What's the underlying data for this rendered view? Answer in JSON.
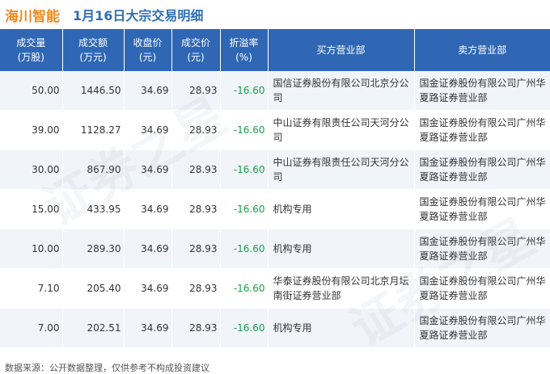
{
  "header": {
    "company": "海川智能",
    "subtitle": "1月16日大宗交易明细"
  },
  "table": {
    "columns": [
      [
        "成交量",
        "(万股)"
      ],
      [
        "成交额",
        "(万元)"
      ],
      [
        "收盘价",
        "(元)"
      ],
      [
        "成交价",
        "(元)"
      ],
      [
        "折溢率",
        "(%)"
      ],
      [
        "买方营业部"
      ],
      [
        "卖方营业部"
      ]
    ],
    "rows": [
      {
        "volume": "50.00",
        "amount": "1446.50",
        "close": "34.69",
        "price": "28.93",
        "premium": "-16.60",
        "buyer": "国信证券股份有限公司北京分公司",
        "seller": "国金证券股份有限公司广州华夏路证券营业部"
      },
      {
        "volume": "39.00",
        "amount": "1128.27",
        "close": "34.69",
        "price": "28.93",
        "premium": "-16.60",
        "buyer": "中山证券有限责任公司天河分公司",
        "seller": "国金证券股份有限公司广州华夏路证券营业部"
      },
      {
        "volume": "30.00",
        "amount": "867.90",
        "close": "34.69",
        "price": "28.93",
        "premium": "-16.60",
        "buyer": "中山证券有限责任公司天河分公司",
        "seller": "国金证券股份有限公司广州华夏路证券营业部"
      },
      {
        "volume": "15.00",
        "amount": "433.95",
        "close": "34.69",
        "price": "28.93",
        "premium": "-16.60",
        "buyer": "机构专用",
        "seller": "国金证券股份有限公司广州华夏路证券营业部"
      },
      {
        "volume": "10.00",
        "amount": "289.30",
        "close": "34.69",
        "price": "28.93",
        "premium": "-16.60",
        "buyer": "机构专用",
        "seller": "国金证券股份有限公司广州华夏路证券营业部"
      },
      {
        "volume": "7.10",
        "amount": "205.40",
        "close": "34.69",
        "price": "28.93",
        "premium": "-16.60",
        "buyer": "华泰证券股份有限公司北京月坛南街证券营业部",
        "seller": "国金证券股份有限公司广州华夏路证券营业部"
      },
      {
        "volume": "7.00",
        "amount": "202.51",
        "close": "34.69",
        "price": "28.93",
        "premium": "-16.60",
        "buyer": "机构专用",
        "seller": "国金证券股份有限公司广州华夏路证券营业部"
      }
    ]
  },
  "footer": {
    "source": "数据来源：公开数据整理，仅供参考不构成投资建议"
  },
  "watermark": {
    "text": "证券之星"
  },
  "colors": {
    "header_bg": "#2f67b4",
    "company_title": "#f08a1d",
    "subtitle": "#2f6fb6",
    "negative": "#1a9d4a"
  }
}
